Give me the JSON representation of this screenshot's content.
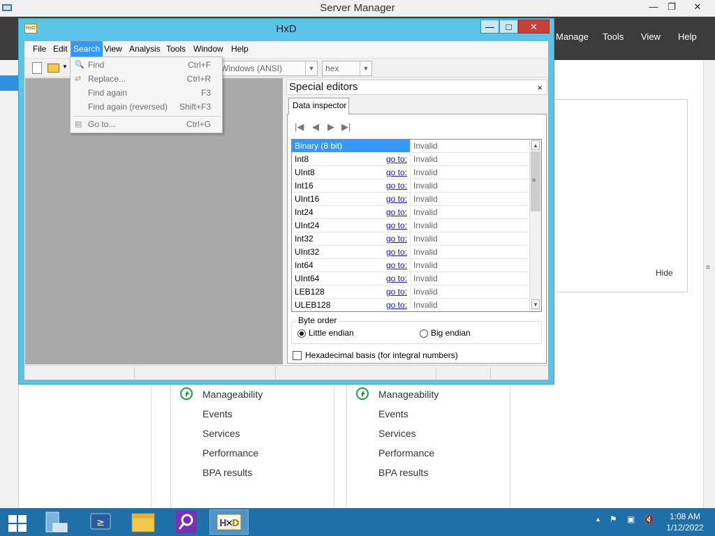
{
  "server_manager": {
    "title": "Server Manager",
    "controls": {
      "minimize": "—",
      "restore": "❐",
      "close": "✕"
    },
    "menu": {
      "manage": "Manage",
      "tools": "Tools",
      "view": "View",
      "help": "Help"
    },
    "panel_hide": "Hide",
    "tiles": [
      {
        "rows": [
          "Manageability",
          "Events",
          "Services",
          "Performance",
          "BPA results"
        ]
      },
      {
        "rows": [
          "Manageability",
          "Events",
          "Services",
          "Performance",
          "BPA results"
        ]
      }
    ]
  },
  "hxd": {
    "title": "HxD",
    "icon_text": "HxD",
    "controls": {
      "minimize": "—",
      "maximize": "□",
      "close": "✕"
    },
    "menu": [
      "File",
      "Edit",
      "Search",
      "View",
      "Analysis",
      "Tools",
      "Window",
      "Help"
    ],
    "toolbar": {
      "charset": "Windows (ANSI)",
      "offset_base": "hex"
    },
    "search_menu": [
      {
        "label": "Find",
        "shortcut": "Ctrl+F",
        "icon": "find-icon",
        "glyph": "🔍"
      },
      {
        "label": "Replace...",
        "shortcut": "Ctrl+R",
        "icon": "replace-icon",
        "glyph": "⇄"
      },
      {
        "label": "Find again",
        "shortcut": "F3",
        "icon": "",
        "glyph": ""
      },
      {
        "label": "Find again (reversed)",
        "shortcut": "Shift+F3",
        "icon": "",
        "glyph": ""
      },
      {
        "label": "Go to...",
        "shortcut": "Ctrl+G",
        "icon": "goto-icon",
        "glyph": "▤"
      }
    ],
    "special_editors": {
      "title": "Special editors",
      "close": "×",
      "tab": "Data inspector",
      "nav": {
        "first": "|◀",
        "prev": "◀",
        "next": "▶",
        "last": "▶|"
      },
      "rows": [
        {
          "type": "Binary (8 bit)",
          "goto": "",
          "value": "Invalid"
        },
        {
          "type": "Int8",
          "goto": "go to:",
          "value": "Invalid"
        },
        {
          "type": "UInt8",
          "goto": "go to:",
          "value": "Invalid"
        },
        {
          "type": "Int16",
          "goto": "go to:",
          "value": "Invalid"
        },
        {
          "type": "UInt16",
          "goto": "go to:",
          "value": "Invalid"
        },
        {
          "type": "Int24",
          "goto": "go to:",
          "value": "Invalid"
        },
        {
          "type": "UInt24",
          "goto": "go to:",
          "value": "Invalid"
        },
        {
          "type": "Int32",
          "goto": "go to:",
          "value": "Invalid"
        },
        {
          "type": "UInt32",
          "goto": "go to:",
          "value": "Invalid"
        },
        {
          "type": "Int64",
          "goto": "go to:",
          "value": "Invalid"
        },
        {
          "type": "UInt64",
          "goto": "go to:",
          "value": "Invalid"
        },
        {
          "type": "LEB128",
          "goto": "go to:",
          "value": "Invalid"
        },
        {
          "type": "ULEB128",
          "goto": "go to:",
          "value": "Invalid"
        }
      ],
      "byte_order": {
        "legend": "Byte order",
        "little": "Little endian",
        "big": "Big endian",
        "selected": "little"
      },
      "hex_basis_label": "Hexadecimal basis (for integral numbers)",
      "hex_basis_checked": false
    }
  },
  "taskbar": {
    "time": "1:08 AM",
    "date": "1/12/2022",
    "apps": [
      "server-manager",
      "powershell",
      "file-explorer",
      "search-tool",
      "hxd"
    ]
  },
  "colors": {
    "hxd_frame": "#5bc3e8",
    "selection": "#3399ff",
    "taskbar": "#1f6fa9",
    "sm_menubar": "#3c3c3c",
    "ok_green": "#1e9e3a"
  }
}
